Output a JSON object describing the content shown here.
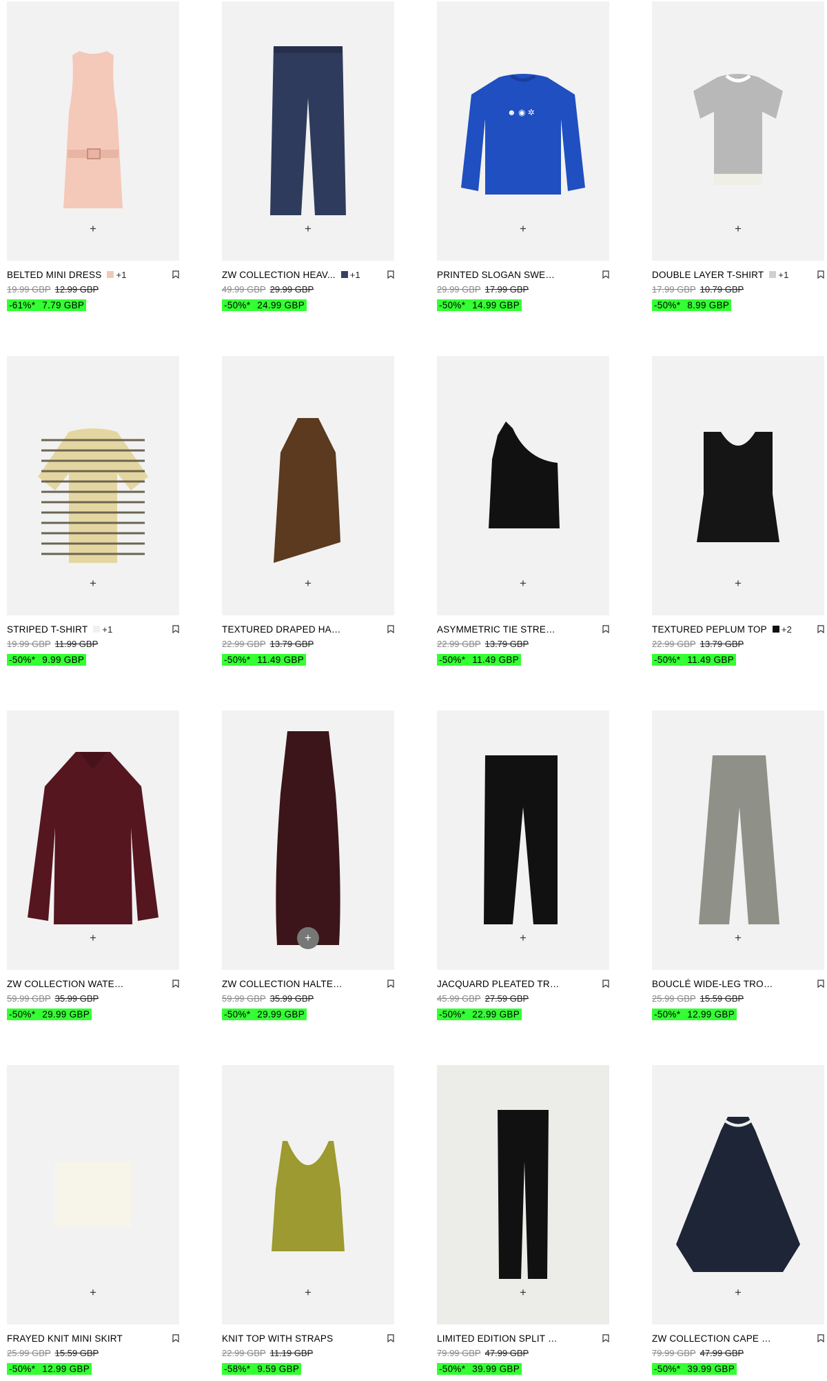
{
  "colors": {
    "sale_bg": "#33ff33",
    "tile_bg": "#f2f2f2"
  },
  "add_icon": "plus-icon",
  "bookmark_icon": "bookmark-icon",
  "products": [
    {
      "name": "BELTED MINI DRESS",
      "swatch": "#f0c8bb",
      "more": "+1",
      "orig": "19.99 GBP",
      "prev": "12.99 GBP",
      "pct": "-61%*",
      "now": "7.79 GBP",
      "item": "dress"
    },
    {
      "name": "ZW COLLECTION HEAV...",
      "swatch": "#3a3f66",
      "more": "+1",
      "orig": "49.99 GBP",
      "prev": "29.99 GBP",
      "pct": "-50%*",
      "now": "24.99 GBP",
      "item": "trousers"
    },
    {
      "name": "PRINTED SLOGAN SWEATSHI...",
      "swatch": "",
      "more": "",
      "orig": "29.99 GBP",
      "prev": "17.99 GBP",
      "pct": "-50%*",
      "now": "14.99 GBP",
      "item": "sweatshirt"
    },
    {
      "name": "DOUBLE LAYER T-SHIRT",
      "swatch": "#cfcfcf",
      "more": "+1",
      "orig": "17.99 GBP",
      "prev": "10.79 GBP",
      "pct": "-50%*",
      "now": "8.99 GBP",
      "item": "tshirt"
    },
    {
      "name": "STRIPED T-SHIRT",
      "swatch": "#eef0f2",
      "more": "+1",
      "orig": "19.99 GBP",
      "prev": "11.99 GBP",
      "pct": "-50%*",
      "now": "9.99 GBP",
      "item": "striped"
    },
    {
      "name": "TEXTURED DRAPED HALTER ...",
      "swatch": "",
      "more": "",
      "orig": "22.99 GBP",
      "prev": "13.79 GBP",
      "pct": "-50%*",
      "now": "11.49 GBP",
      "item": "halter"
    },
    {
      "name": "ASYMMETRIC TIE STRETCH T...",
      "swatch": "",
      "more": "",
      "orig": "22.99 GBP",
      "prev": "13.79 GBP",
      "pct": "-50%*",
      "now": "11.49 GBP",
      "item": "asym"
    },
    {
      "name": "TEXTURED PEPLUM TOP",
      "swatch": "#111111",
      "more": "+2",
      "orig": "22.99 GBP",
      "prev": "13.79 GBP",
      "pct": "-50%*",
      "now": "11.49 GBP",
      "item": "peplum"
    },
    {
      "name": "ZW COLLECTION WATER-REP...",
      "swatch": "",
      "more": "",
      "orig": "59.99 GBP",
      "prev": "35.99 GBP",
      "pct": "-50%*",
      "now": "29.99 GBP",
      "item": "coat"
    },
    {
      "name": "ZW COLLECTION HALTER DR...",
      "swatch": "",
      "more": "",
      "orig": "59.99 GBP",
      "prev": "35.99 GBP",
      "pct": "-50%*",
      "now": "29.99 GBP",
      "item": "longdress"
    },
    {
      "name": "JACQUARD PLEATED TROUS...",
      "swatch": "",
      "more": "",
      "orig": "45.99 GBP",
      "prev": "27.59 GBP",
      "pct": "-50%*",
      "now": "22.99 GBP",
      "item": "blacktrousers"
    },
    {
      "name": "BOUCLÉ WIDE-LEG TROUSERS",
      "swatch": "",
      "more": "",
      "orig": "25.99 GBP",
      "prev": "15.59 GBP",
      "pct": "-50%*",
      "now": "12.99 GBP",
      "item": "greytrousers"
    },
    {
      "name": "FRAYED KNIT MINI SKIRT",
      "swatch": "",
      "more": "",
      "orig": "25.99 GBP",
      "prev": "15.59 GBP",
      "pct": "-50%*",
      "now": "12.99 GBP",
      "item": "skirt"
    },
    {
      "name": "KNIT TOP WITH STRAPS",
      "swatch": "",
      "more": "",
      "orig": "22.99 GBP",
      "prev": "11.19 GBP",
      "pct": "-58%*",
      "now": "9.59 GBP",
      "item": "knittop"
    },
    {
      "name": "LIMITED EDITION SPLIT HEM ...",
      "swatch": "",
      "more": "",
      "orig": "79.99 GBP",
      "prev": "47.99 GBP",
      "pct": "-50%*",
      "now": "39.99 GBP",
      "item": "splithem"
    },
    {
      "name": "ZW COLLECTION CAPE JACK...",
      "swatch": "",
      "more": "",
      "orig": "79.99 GBP",
      "prev": "47.99 GBP",
      "pct": "-50%*",
      "now": "39.99 GBP",
      "item": "cape"
    }
  ]
}
